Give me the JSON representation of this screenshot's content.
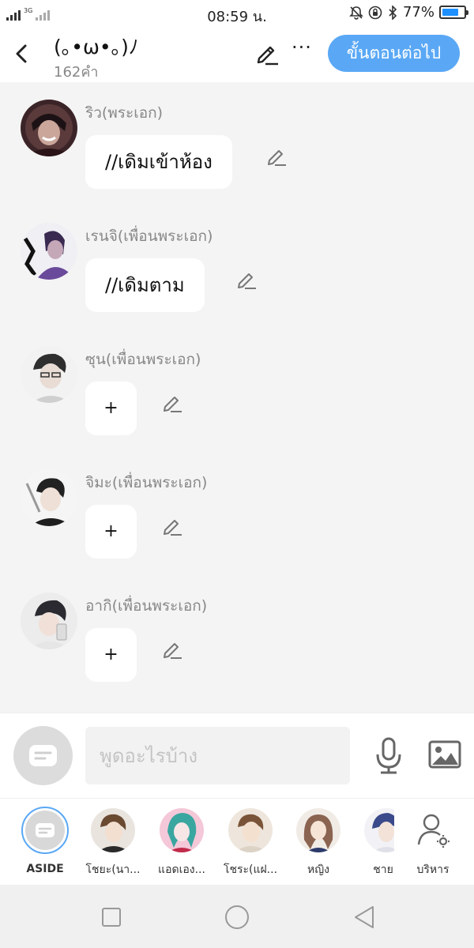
{
  "status_bar": {
    "network": "3G",
    "time": "08:59 น.",
    "battery_percent": "77%",
    "battery_level": 0.77,
    "icons": [
      "signal-icon",
      "mute-icon",
      "rotation-lock-icon",
      "bluetooth-icon",
      "battery-icon"
    ]
  },
  "header": {
    "title": "(｡•ω•｡)ﾉ",
    "subtitle": "162คำ",
    "next_button_label": "ขั้นตอนต่อไป",
    "more_label": "···"
  },
  "messages": [
    {
      "character": "ริว(พระเอก)",
      "text": "//เดิมเข้าห้อง"
    },
    {
      "character": "เรนจิ(เพื่อนพระเอก)",
      "text": "//เดิมตาม"
    },
    {
      "character": "ซุน(เพื่อนพระเอก)",
      "text": "+"
    },
    {
      "character": "จิมะ(เพื่อนพระเอก)",
      "text": "+"
    },
    {
      "character": "อากิ(เพื่อนพระเอก)",
      "text": "+"
    }
  ],
  "input": {
    "placeholder": "พูดอะไรบ้าง",
    "value": ""
  },
  "character_bar": {
    "items": [
      {
        "label": "ASIDE"
      },
      {
        "label": "โชยะ(นา..."
      },
      {
        "label": "แอดเอง..."
      },
      {
        "label": "โชระ(แฝ..."
      },
      {
        "label": "หญิง"
      },
      {
        "label": "ชาย"
      },
      {
        "label": "บริหาร"
      }
    ]
  },
  "colors": {
    "accent": "#5aa8f5",
    "background": "#f4f4f4",
    "bubble": "#ffffff"
  }
}
